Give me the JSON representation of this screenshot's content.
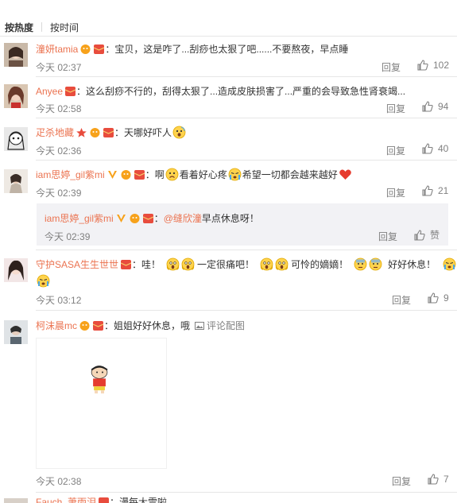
{
  "sort": {
    "hot": "按热度",
    "time": "按时间"
  },
  "comments": [
    {
      "user": "潼妍tamia",
      "text": "：宝贝，这是咋了...刮痧也太狠了吧......不要熬夜，早点睡",
      "time": "今天 02:37",
      "reply": "回复",
      "likes": "102"
    },
    {
      "user": "Anyee",
      "text": "：这么刮痧不行的，刮得太狠了...造成皮肤损害了...严重的会导致急性肾衰竭...",
      "time": "今天 02:58",
      "reply": "回复",
      "likes": "94"
    },
    {
      "user": "疋杀地藏",
      "text": "：天哪好吓人",
      "time": "今天 02:36",
      "reply": "回复",
      "likes": "40"
    },
    {
      "user": "iam思婷_gil紫mi",
      "text_a": "：啊",
      "text_b": "看着好心疼",
      "text_c": "希望一切都会越来越好",
      "time": "今天 02:39",
      "reply": "回复",
      "likes": "21"
    },
    {
      "user": "守护SASA生生世世",
      "text_a": "：哇！",
      "text_b": "一定很痛吧！",
      "text_c": "可怜的嫡嫡！",
      "text_d": "好好休息！",
      "time": "今天 03:12",
      "reply": "回复",
      "likes": "9"
    },
    {
      "user": "柯沫晨mc",
      "text": "：姐姐好好休息，哦",
      "link": "评论配图",
      "time": "今天 02:38",
      "reply": "回复",
      "likes": "7"
    }
  ],
  "subreply": {
    "user": "iam思婷_gil紫mi",
    "mention": "@缝欣潼",
    "text": " 早点休息呀！",
    "time": "今天 02:39",
    "reply": "回复",
    "like_label": "赞"
  },
  "partial": {
    "user": "Fauch_萧雨泪",
    "text": "：漫每大雪啦"
  },
  "colors": {
    "username": "#eb7350",
    "text": "#333333",
    "meta": "#808080",
    "subbox_bg": "#f2f2f5",
    "divider": "#e6e6e6"
  }
}
